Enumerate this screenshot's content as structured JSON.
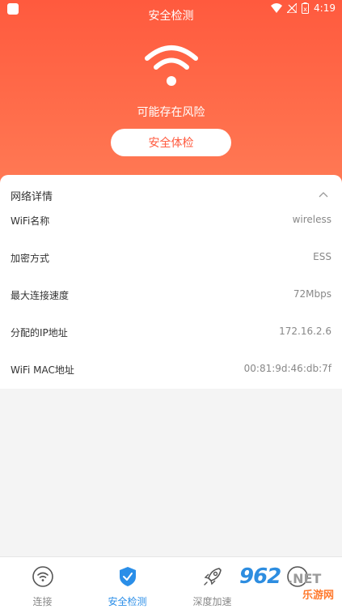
{
  "status": {
    "time": "4:19"
  },
  "header": {
    "title": "安全检测",
    "risk_text": "可能存在风险",
    "check_button": "安全体检"
  },
  "details": {
    "title": "网络详情",
    "rows": [
      {
        "label": "WiFi名称",
        "value": "wireless"
      },
      {
        "label": "加密方式",
        "value": "ESS"
      },
      {
        "label": "最大连接速度",
        "value": "72Mbps"
      },
      {
        "label": "分配的IP地址",
        "value": "172.16.2.6"
      },
      {
        "label": "WiFi MAC地址",
        "value": "00:81:9d:46:db:7f"
      }
    ]
  },
  "tabs": [
    {
      "label": "连接",
      "icon": "wifi-icon"
    },
    {
      "label": "安全检测",
      "icon": "shield-check-icon"
    },
    {
      "label": "深度加速",
      "icon": "rocket-icon"
    },
    {
      "label": "",
      "icon": "more-icon"
    }
  ],
  "watermark": {
    "number": "962",
    "suffix": ".NET",
    "site": "乐游网"
  },
  "colors": {
    "accent": "#ff5a3e",
    "tab_active": "#2a8ee8"
  }
}
